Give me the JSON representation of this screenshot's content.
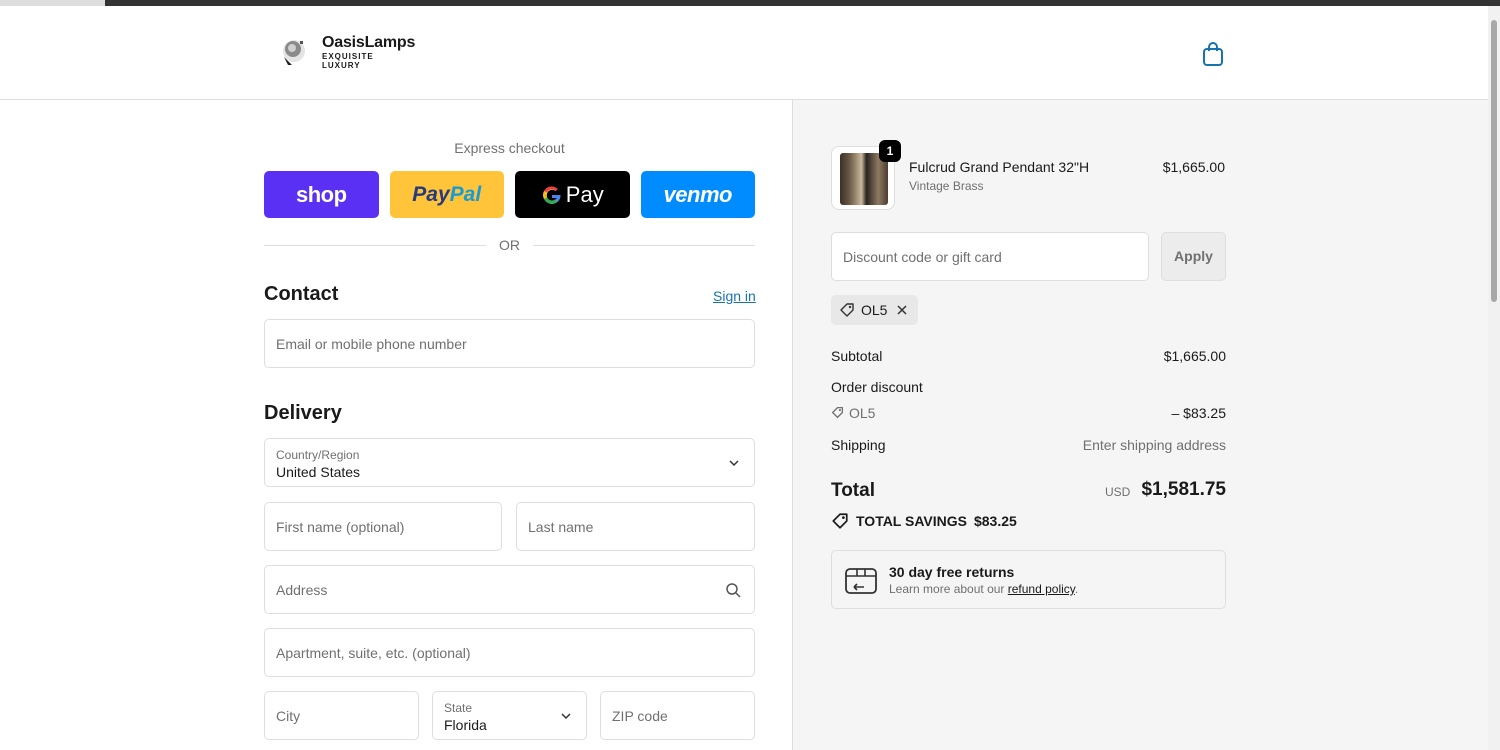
{
  "header": {
    "brand": "OasisLamps",
    "tagline_1": "EXQUISITE",
    "tagline_2": "LUXURY"
  },
  "express": {
    "title": "Express checkout",
    "shop_label": "shop",
    "paypal_pay": "Pay",
    "paypal_pal": "Pal",
    "gpay_label": "Pay",
    "venmo_label": "venmo",
    "or_label": "OR"
  },
  "contact": {
    "title": "Contact",
    "sign_in": "Sign in",
    "email_placeholder": "Email or mobile phone number"
  },
  "delivery": {
    "title": "Delivery",
    "country_label": "Country/Region",
    "country_value": "United States",
    "first_name_placeholder": "First name (optional)",
    "last_name_placeholder": "Last name",
    "address_placeholder": "Address",
    "apartment_placeholder": "Apartment, suite, etc. (optional)",
    "city_placeholder": "City",
    "state_label": "State",
    "state_value": "Florida",
    "zip_placeholder": "ZIP code"
  },
  "summary": {
    "item": {
      "quantity": "1",
      "name": "Fulcrud Grand Pendant 32\"H",
      "variant": "Vintage Brass",
      "price": "$1,665.00"
    },
    "discount_placeholder": "Discount code or gift card",
    "apply_label": "Apply",
    "applied_code": "OL5",
    "subtotal_label": "Subtotal",
    "subtotal_value": "$1,665.00",
    "order_discount_label": "Order discount",
    "discount_code": "OL5",
    "discount_value": "– $83.25",
    "shipping_label": "Shipping",
    "shipping_value": "Enter shipping address",
    "total_label": "Total",
    "currency": "USD",
    "total_value": "$1,581.75",
    "savings_label": "TOTAL SAVINGS",
    "savings_value": "$83.25",
    "returns_title": "30 day free returns",
    "returns_text": "Learn more about our ",
    "returns_link": "refund policy",
    "returns_end": "."
  },
  "colors": {
    "shop": "#5a31f4",
    "paypal": "#ffc439",
    "gpay": "#000000",
    "venmo": "#008cff",
    "link": "#1773b0"
  }
}
